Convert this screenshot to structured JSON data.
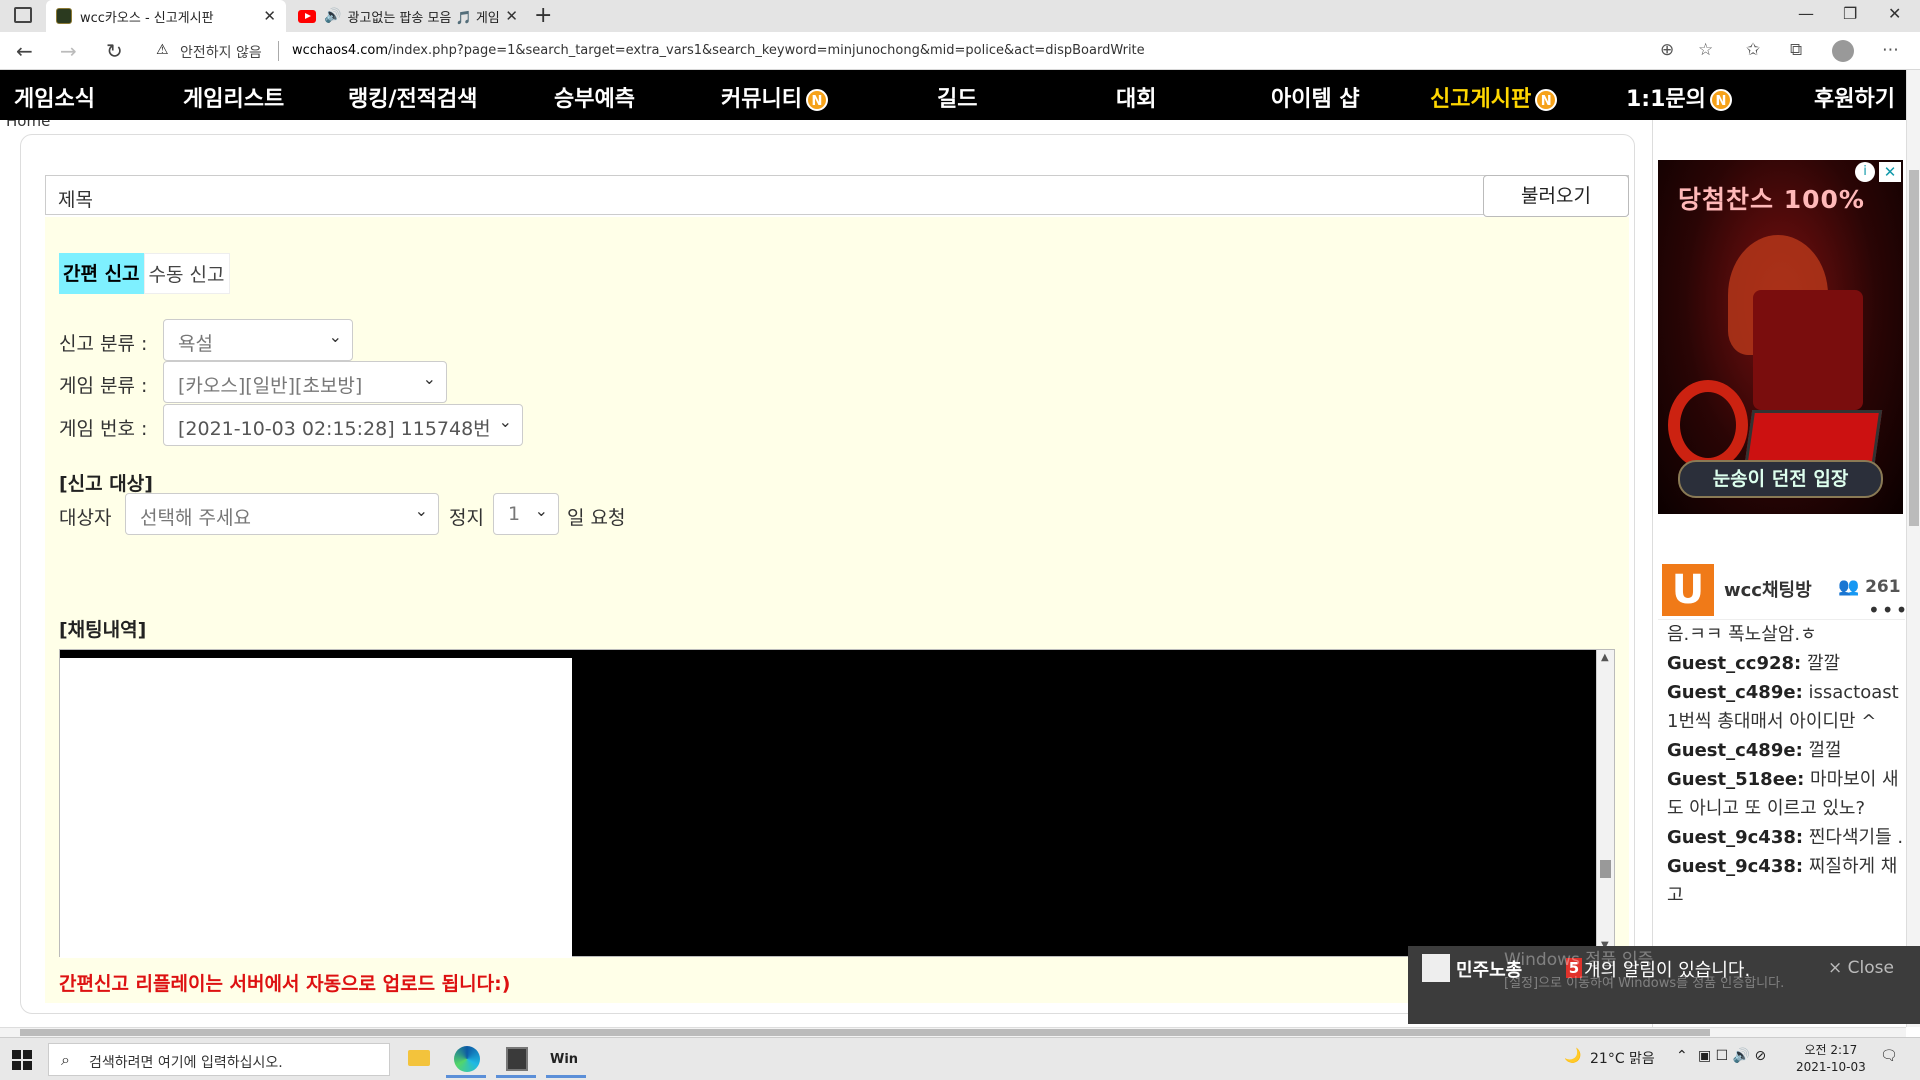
{
  "browser": {
    "tabs": [
      {
        "title": "wcc카오스 - 신고게시판",
        "active": true
      },
      {
        "title": "광고없는 팝송 모음 🎵 게임",
        "active": false
      }
    ],
    "security_label": "안전하지 않음",
    "url_host": "wcchaos4.com",
    "url_path": "/index.php?page=1&search_target=extra_vars1&search_keyword=minjunochong&mid=police&act=dispBoardWrite"
  },
  "nav": {
    "items": [
      "게임소식",
      "게임리스트",
      "랭킹/전적검색",
      "승부예측",
      "커뮤니티",
      "길드",
      "대회",
      "아이템 샵",
      "신고게시판",
      "1:1문의",
      "후원하기"
    ],
    "badge_letter": "N"
  },
  "page": {
    "breadcrumb": "Home",
    "title_placeholder": "제목",
    "load_button": "불러오기",
    "mode_tabs": [
      "간편 신고",
      "수동 신고"
    ],
    "report_type_label": "신고 분류 :",
    "report_type_value": "욕설",
    "game_type_label": "게임 분류 :",
    "game_type_value": "[카오스][일반][초보방]",
    "game_no_label": "게임 번호 :",
    "game_no_value": "[2021-10-03 02:15:28] 115748번",
    "target_section": "[신고 대상]",
    "target_label": "대상자",
    "target_value": "선택해 주세요",
    "ban_label": "정지",
    "ban_days": "1",
    "ban_suffix": "일 요청",
    "chat_section": "[채팅내역]",
    "notice": "간편신고 리플레이는 서버에서 자동으로 업로드 됩니다:)"
  },
  "sidebar": {
    "ad_title": "당첨찬스 100%",
    "ad_button": "눈송이 던전 입장",
    "chat_logo": "U",
    "chat_name": "wcc채팅방",
    "chat_count": "261",
    "messages": [
      {
        "user": "",
        "text": "음.ㅋㅋ 폭노살암.ㅎ"
      },
      {
        "user": "Guest_cc928:",
        "text": "깔깔"
      },
      {
        "user": "Guest_c489e:",
        "text": "issactoast ="
      },
      {
        "user": "",
        "text": "1번씩 총대매서 아이디만 ^"
      },
      {
        "user": "Guest_c489e:",
        "text": "껄껄"
      },
      {
        "user": "Guest_518ee:",
        "text": "마마보이 새"
      },
      {
        "user": "",
        "text": "도 아니고 또 이르고 있노?"
      },
      {
        "user": "Guest_9c438:",
        "text": "찐다색기들 ."
      },
      {
        "user": "Guest_9c438:",
        "text": "찌질하게 채"
      },
      {
        "user": "",
        "text": "고"
      }
    ]
  },
  "toast": {
    "name": "민주노총",
    "count": "5",
    "message": "개의 알림이 있습니다.",
    "close": "× Close"
  },
  "watermark": {
    "line1": "Windows 정품 인증",
    "line2": "[설정]으로 이동하여 Windows를 정품 인증합니다."
  },
  "taskbar": {
    "search_placeholder": "검색하려면 여기에 입력하십시오.",
    "weather": "21°C 맑음",
    "time": "오전 2:17",
    "date": "2021-10-03",
    "app_label": "Win"
  }
}
